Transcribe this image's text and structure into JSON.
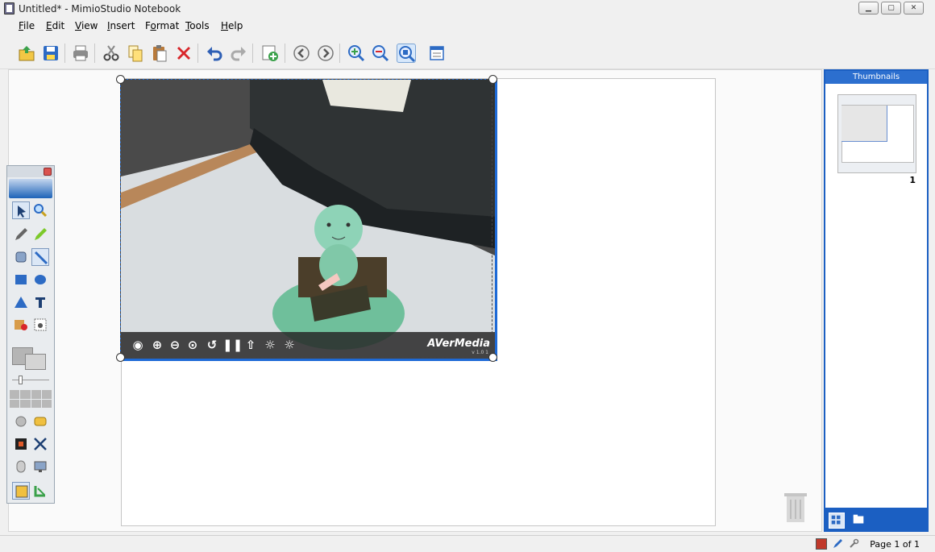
{
  "window": {
    "title": "Untitled* - MimioStudio Notebook",
    "controls": [
      "minimize",
      "restore",
      "close"
    ]
  },
  "menu": {
    "items": [
      {
        "label": "File",
        "u": "F",
        "rest": "ile"
      },
      {
        "label": "Edit",
        "u": "E",
        "rest": "dit"
      },
      {
        "label": "View",
        "u": "V",
        "rest": "iew"
      },
      {
        "label": "Insert",
        "u": "I",
        "rest": "nsert"
      },
      {
        "label": "Format",
        "pre": "F",
        "u": "o",
        "rest": "rmat"
      },
      {
        "label": "Tools",
        "u": "T",
        "rest": "ools"
      },
      {
        "label": "Help",
        "u": "H",
        "rest": "elp"
      }
    ]
  },
  "toolbar": {
    "buttons": [
      "open-icon",
      "save-icon",
      "print-icon",
      "cut-icon",
      "copy-icon",
      "paste-icon",
      "delete-icon",
      "undo-icon",
      "redo-icon",
      "add-page-icon",
      "previous-page-icon",
      "next-page-icon",
      "zoom-in-icon",
      "zoom-out-icon",
      "zoom-fit-icon",
      "page-view-icon"
    ],
    "active": "zoom-fit-icon"
  },
  "camera_overlay": {
    "controls": [
      "eye-icon",
      "zoom-in-icon",
      "zoom-out-icon",
      "zoom-fit-icon",
      "rotate-icon",
      "pause-icon",
      "capture-icon",
      "brightness-up-icon",
      "brightness-down-icon"
    ],
    "brand": "AVerMedia",
    "version": "v 1.0 1"
  },
  "thumbnails": {
    "title": "Thumbnails",
    "pages": [
      {
        "number": "1"
      }
    ]
  },
  "status": {
    "page": "Page 1 of 1"
  },
  "colors": {
    "selection": "#1e6ad6",
    "thumbnail_accent": "#1b5fc2"
  }
}
